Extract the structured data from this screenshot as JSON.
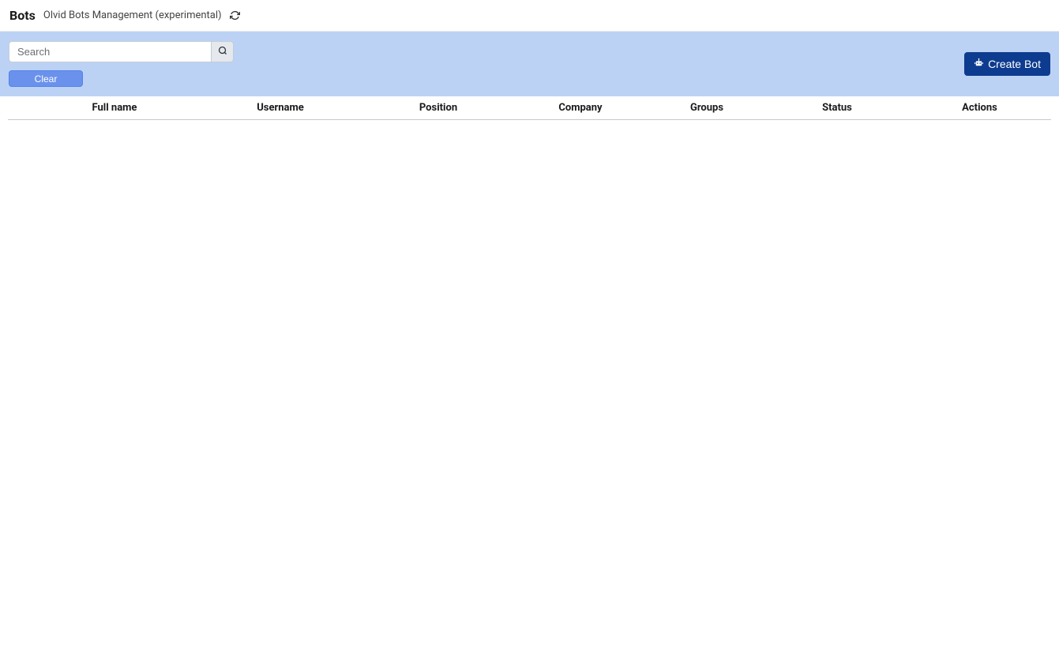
{
  "header": {
    "title": "Bots",
    "subtitle": "Olvid Bots Management (experimental)"
  },
  "toolbar": {
    "search_placeholder": "Search",
    "clear_label": "Clear",
    "create_bot_label": "Create Bot"
  },
  "table": {
    "columns": {
      "fullname": "Full name",
      "username": "Username",
      "position": "Position",
      "company": "Company",
      "groups": "Groups",
      "status": "Status",
      "actions": "Actions"
    },
    "rows": []
  }
}
